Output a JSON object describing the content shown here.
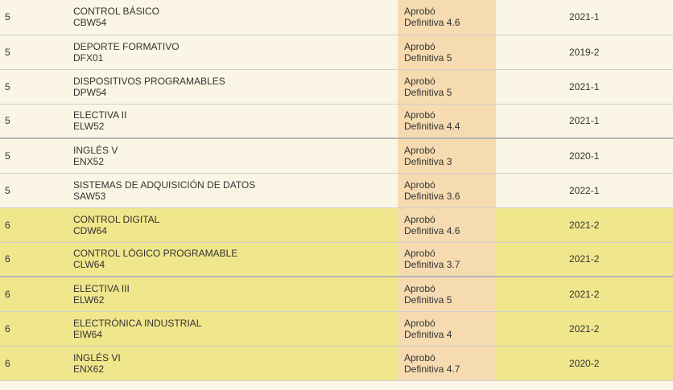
{
  "rows": [
    {
      "semester": "5",
      "name": "CONTROL BÁSICO",
      "code": "CBW54",
      "status": "Aprobó",
      "grade": "Definitiva 4.6",
      "period": "2021-1"
    },
    {
      "semester": "5",
      "name": "DEPORTE FORMATIVO",
      "code": "DFX01",
      "status": "Aprobó",
      "grade": "Definitiva 5",
      "period": "2019-2"
    },
    {
      "semester": "5",
      "name": "DISPOSITIVOS PROGRAMABLES",
      "code": "DPW54",
      "status": "Aprobó",
      "grade": "Definitiva 5",
      "period": "2021-1"
    },
    {
      "semester": "5",
      "name": "ELECTIVA II",
      "code": "ELW52",
      "status": "Aprobó",
      "grade": "Definitiva 4.4",
      "period": "2021-1"
    },
    {
      "semester": "5",
      "name": "INGLÉS V",
      "code": "ENX52",
      "status": "Aprobó",
      "grade": "Definitiva 3",
      "period": "2020-1"
    },
    {
      "semester": "5",
      "name": "SISTEMAS DE ADQUISICIÓN DE DATOS",
      "code": "SAW53",
      "status": "Aprobó",
      "grade": "Definitiva 3.6",
      "period": "2022-1"
    },
    {
      "semester": "6",
      "name": "CONTROL DIGITAL",
      "code": "CDW64",
      "status": "Aprobó",
      "grade": "Definitiva 4.6",
      "period": "2021-2"
    },
    {
      "semester": "6",
      "name": "CONTROL LÓGICO PROGRAMABLE",
      "code": "CLW64",
      "status": "Aprobó",
      "grade": "Definitiva 3.7",
      "period": "2021-2"
    },
    {
      "semester": "6",
      "name": "ELECTIVA III",
      "code": "ELW62",
      "status": "Aprobó",
      "grade": "Definitiva 5",
      "period": "2021-2"
    },
    {
      "semester": "6",
      "name": "ELECTRÓNICA INDUSTRIAL",
      "code": "EIW64",
      "status": "Aprobó",
      "grade": "Definitiva 4",
      "period": "2021-2"
    },
    {
      "semester": "6",
      "name": "INGLÉS VI",
      "code": "ENX62",
      "status": "Aprobó",
      "grade": "Definitiva 4.7",
      "period": "2020-2"
    }
  ]
}
